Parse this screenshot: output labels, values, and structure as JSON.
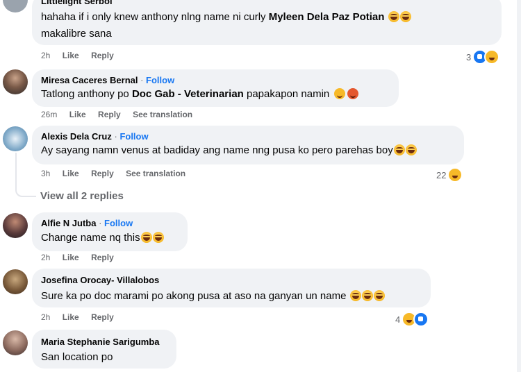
{
  "comments": [
    {
      "author": "Littlelight Serbol",
      "text_1": "hahaha if i only knew anthony nlng name ni curly ",
      "mention": "Myleen Dela Paz Potian",
      "text_2": "makalibre sana",
      "time": "2h",
      "like": "Like",
      "reply": "Reply",
      "reaction_count": "3",
      "reaction_icons": [
        "like-icon",
        "haha-icon"
      ]
    },
    {
      "author": "Miresa Caceres Bernal",
      "follow": "Follow",
      "text_1": "Tatlong anthony po ",
      "mention": "Doc Gab - Veterinarian",
      "text_2": " papakapon namin",
      "time": "26m",
      "like": "Like",
      "reply": "Reply",
      "see_translation": "See translation"
    },
    {
      "author": "Alexis Dela Cruz",
      "follow": "Follow",
      "text_1": "Ay sayang namn venus at badiday ang name nng pusa ko pero parehas boy",
      "time": "3h",
      "like": "Like",
      "reply": "Reply",
      "see_translation": "See translation",
      "reaction_count": "22",
      "reaction_icons": [
        "haha-icon"
      ]
    },
    {
      "author": "Alfie N Jutba",
      "follow": "Follow",
      "text_1": "Change name nq this",
      "time": "2h",
      "like": "Like",
      "reply": "Reply"
    },
    {
      "author": "Josefina Orocay- Villalobos",
      "text_1": "Sure ka po doc marami po akong pusa at aso na ganyan un name ",
      "time": "2h",
      "like": "Like",
      "reply": "Reply",
      "reaction_count": "4",
      "reaction_icons": [
        "haha-icon",
        "like-icon"
      ]
    },
    {
      "author": "Maria Stephanie Sarigumba",
      "text_1": "San location po"
    }
  ],
  "view_replies": "View all 2 replies",
  "dot": " · ",
  "colors": {
    "bubble": "#f0f2f5",
    "link": "#1877f2",
    "meta": "#65676b",
    "text": "#050505"
  }
}
